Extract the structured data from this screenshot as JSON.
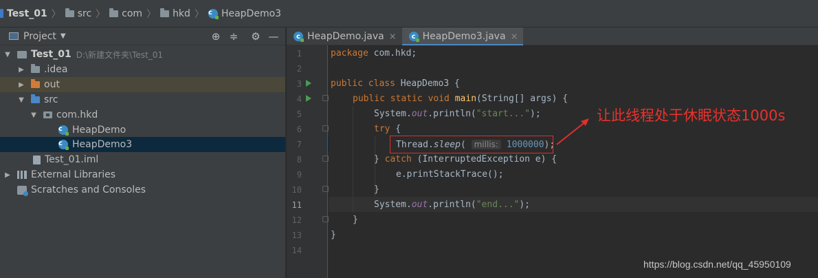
{
  "breadcrumb": [
    {
      "label": "Test_01",
      "icon": "project-icon",
      "bold": true
    },
    {
      "label": "src",
      "icon": "folder-icon"
    },
    {
      "label": "com",
      "icon": "folder-icon"
    },
    {
      "label": "hkd",
      "icon": "folder-icon"
    },
    {
      "label": "HeapDemo3",
      "icon": "java-class-icon"
    }
  ],
  "project_panel": {
    "title": "Project",
    "tree": [
      {
        "label": "Test_01",
        "path": "D:\\新建文件夹\\Test_01",
        "bold": true,
        "expanded": true
      },
      {
        "label": ".idea",
        "expanded": false
      },
      {
        "label": "out",
        "expanded": false
      },
      {
        "label": "src",
        "expanded": true
      },
      {
        "label": "com.hkd",
        "expanded": true
      },
      {
        "label": "HeapDemo"
      },
      {
        "label": "HeapDemo3",
        "selected": true
      },
      {
        "label": "Test_01.iml"
      },
      {
        "label": "External Libraries",
        "expanded": false
      },
      {
        "label": "Scratches and Consoles"
      }
    ]
  },
  "editor": {
    "tabs": [
      {
        "label": "HeapDemo.java",
        "active": false
      },
      {
        "label": "HeapDemo3.java",
        "active": true
      }
    ],
    "line_numbers": [
      "1",
      "2",
      "3",
      "4",
      "5",
      "6",
      "7",
      "8",
      "9",
      "10",
      "11",
      "12",
      "13",
      "14"
    ],
    "current_line": "11",
    "code": {
      "l1_kw": "package",
      "l1_rest": " com.hkd;",
      "l3_kw": "public class",
      "l3_rest": " HeapDemo3 {",
      "l4_kw": "public static void",
      "l4_fn": "main",
      "l4_rest": "(String[] args) {",
      "l5_a": "System.",
      "l5_field": "out",
      "l5_b": ".println(",
      "l5_str": "\"start...\"",
      "l5_c": ");",
      "l6_kw": "try",
      "l6_rest": " {",
      "l7_a": "Thread.",
      "l7_method": "sleep",
      "l7_b": "( ",
      "l7_hint": "millis:",
      "l7_num": "1000000",
      "l7_c": ");",
      "l8_a": "} ",
      "l8_kw": "catch",
      "l8_rest": " (InterruptedException e) {",
      "l9": "e.printStackTrace();",
      "l10": "}",
      "l11_a": "System.",
      "l11_field": "out",
      "l11_b": ".println(",
      "l11_str": "\"end...\"",
      "l11_c": ");",
      "l12": "}",
      "l13": "}"
    }
  },
  "annotation": {
    "text": "让此线程处于休眠状态1000s",
    "color": "#e8322d"
  },
  "watermark": "https://blog.csdn.net/qq_45950109",
  "colors": {
    "keyword": "#cc7832",
    "string": "#6a8759",
    "number": "#6897bb",
    "field": "#9876aa",
    "method": "#ffc66d",
    "selection": "#0d293e",
    "accent": "#4a88c7"
  }
}
